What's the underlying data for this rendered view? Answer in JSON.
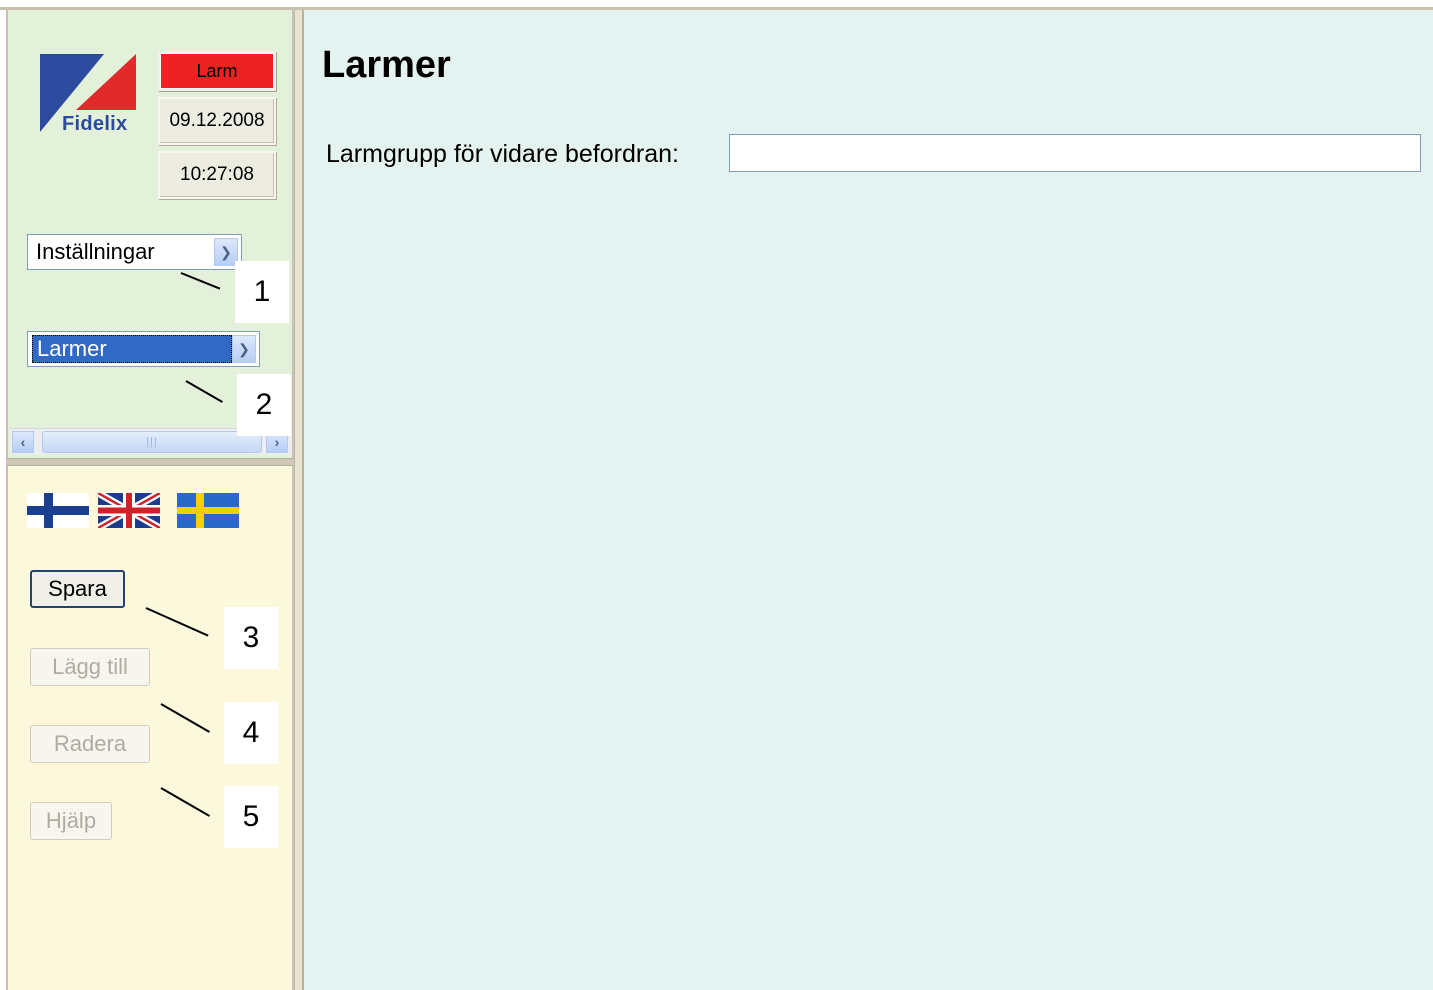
{
  "logo": {
    "text": "Fidelix",
    "colors": {
      "blue": "#2c4a9e",
      "red": "#e32a2a"
    }
  },
  "status": {
    "alarm_label": "Larm",
    "alarm_color": "#ee2222",
    "date": "09.12.2008",
    "time": "10:27:08"
  },
  "navigation": {
    "category_select": {
      "value": "Inställningar"
    },
    "page_select": {
      "value": "Larmer"
    }
  },
  "callouts": [
    "1",
    "2",
    "3",
    "4",
    "5"
  ],
  "languages": [
    {
      "name": "Finnish",
      "icon": "finland-flag-icon"
    },
    {
      "name": "English",
      "icon": "uk-flag-icon"
    },
    {
      "name": "Swedish",
      "icon": "sweden-flag-icon"
    }
  ],
  "actions": {
    "save_label": "Spara",
    "add_label": "Lägg till",
    "delete_label": "Radera",
    "help_label": "Hjälp"
  },
  "main": {
    "title": "Larmer",
    "forward_group": {
      "label": "Larmgrupp för vidare befordran:",
      "value": ""
    }
  }
}
